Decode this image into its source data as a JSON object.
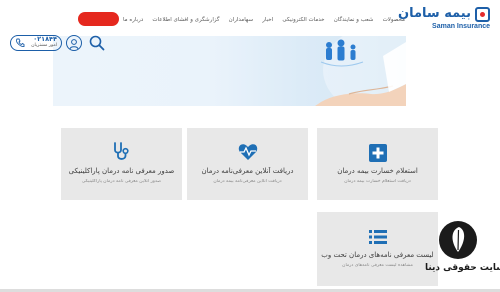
{
  "header": {
    "logo_text_fa": "بیمه سامان",
    "logo_text_en": "Saman Insurance",
    "nav": [
      "محصولات",
      "شعب و نمایندگان",
      "خدمات الکترونیکی",
      "اخبار",
      "سهامداران",
      "گزارشگری و افشای اطلاعات",
      "درباره ما"
    ],
    "red_button_label": "",
    "phone_number": "۰۲۱۸۴۴",
    "phone_caption": "امور مشتریان"
  },
  "cards": [
    {
      "title": "استعلام خسارت بیمه درمان",
      "subtitle": "دریافت استعلام خسارت بیمه درمان",
      "icon": "plus-icon"
    },
    {
      "title": "دریافت آنلاین معرفی‌نامه درمان",
      "subtitle": "دریافت آنلاین معرفی‌نامه بیمه درمان",
      "icon": "heartbeat-icon"
    },
    {
      "title": "صدور معرفی نامه درمان پاراکلینیکی",
      "subtitle": "صدور آنلاین معرفی نامه درمان پاراکلینیکی",
      "icon": "stethoscope-icon"
    },
    {
      "title": "لیست معرفی نامه‌های درمان تحت وب",
      "subtitle": "مشاهده لیست معرفی نامه‌های درمان",
      "icon": "list-icon"
    }
  ],
  "watermark": {
    "text": "سایت حقوقی دینا"
  },
  "colors": {
    "brand_blue": "#1d5fa8",
    "icon_blue": "#1f6fb5",
    "accent_red": "#e5281e",
    "card_bg": "#e8e8e8"
  }
}
